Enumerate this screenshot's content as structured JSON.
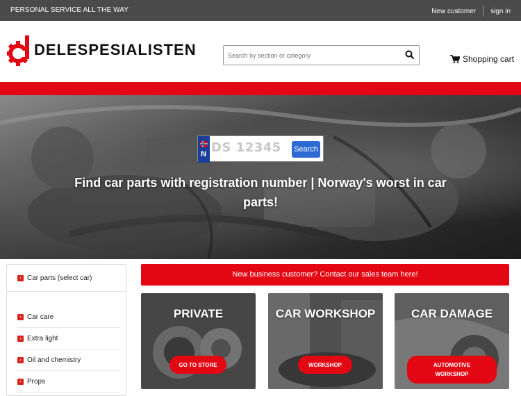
{
  "topbar": {
    "tagline": "PERSONAL SERVICE ALL THE WAY",
    "new_customer": "New customer",
    "sign_in": "sign in"
  },
  "header": {
    "brand": "DELESPESIALISTEN",
    "search_placeholder": "Search by section or category",
    "cart_label": "Shopping cart"
  },
  "colors": {
    "brand_red": "#e30613",
    "topbar_gray": "#4a4a4a",
    "search_blue": "#2d6bd3"
  },
  "hero": {
    "plate_country": "N",
    "plate_placeholder": "DS 12345",
    "plate_button": "Search",
    "title": "Find car parts with registration number | Norway's worst in car parts!"
  },
  "sidebar": {
    "items": [
      {
        "label": "Car parts (select car)"
      },
      {
        "label": "Car care"
      },
      {
        "label": "Extra light"
      },
      {
        "label": "Oil and chemistry"
      },
      {
        "label": "Props"
      }
    ]
  },
  "promo": {
    "text": "New business customer? Contact our sales team here!"
  },
  "tiles": [
    {
      "title": "PRIVATE",
      "button": "GO TO STORE"
    },
    {
      "title": "CAR WORKSHOP",
      "button": "WORKSHOP"
    },
    {
      "title": "CAR DAMAGE",
      "button": "AUTOMOTIVE WORKSHOP"
    }
  ],
  "icons": {
    "logo": "gear-wrench-logo-icon",
    "search": "magnifier-icon",
    "cart": "shopping-cart-icon",
    "flag": "norway-flag-icon",
    "chevron": "chevron-right-icon"
  }
}
